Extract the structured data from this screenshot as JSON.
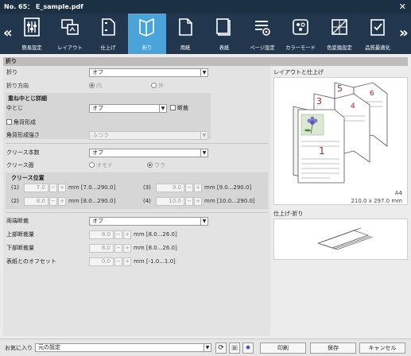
{
  "window": {
    "title": "No. 65： E_sample.pdf",
    "close": "✕"
  },
  "toolbar": {
    "prev": "«",
    "next": "»",
    "items": [
      {
        "label": "簡易設定",
        "icon": "simple-settings-icon"
      },
      {
        "label": "レイアウト",
        "icon": "layout-icon"
      },
      {
        "label": "仕上げ",
        "icon": "finishing-icon"
      },
      {
        "label": "折り",
        "icon": "fold-icon",
        "active": true
      },
      {
        "label": "用紙",
        "icon": "paper-icon"
      },
      {
        "label": "表紙",
        "icon": "cover-icon"
      },
      {
        "label": "ページ設定",
        "icon": "page-settings-icon"
      },
      {
        "label": "カラーモード",
        "icon": "color-mode-icon"
      },
      {
        "label": "色変換設定",
        "icon": "color-conversion-icon"
      },
      {
        "label": "品質最適化",
        "icon": "quality-icon"
      }
    ]
  },
  "section_title": "折り",
  "fold": {
    "label": "折り",
    "value": "オフ",
    "direction_label": "折り方向",
    "direction_in": "内",
    "direction_out": "外"
  },
  "saddle": {
    "title": "重ね中とじ詳細",
    "stitch_label": "中とじ",
    "stitch_value": "オフ",
    "trim_label": "断裁",
    "square_label": "角背形成",
    "strength_label": "角背形成強さ",
    "strength_value": "ふつう"
  },
  "crease": {
    "count_label": "クリース本数",
    "count_value": "オフ",
    "side_label": "クリース面",
    "side_front": "オモテ",
    "side_back": "ウラ",
    "pos_title": "クリース位置",
    "positions": [
      {
        "label": "(1)",
        "value": "7.0",
        "range": "mm [7.0...290.0]"
      },
      {
        "label": "(2)",
        "value": "8.0",
        "range": "mm [8.0...290.0]"
      },
      {
        "label": "(3)",
        "value": "9.0",
        "range": "mm [9.0...290.0]"
      },
      {
        "label": "(4)",
        "value": "10.0",
        "range": "mm [10.0...290.0]"
      }
    ]
  },
  "trim": {
    "label": "両端断裁",
    "value": "オフ",
    "top_label": "上部断裁量",
    "top_value": "8.0",
    "top_range": "mm [8.0...26.0]",
    "bottom_label": "下部断裁量",
    "bottom_value": "8.0",
    "bottom_range": "mm [8.0...26.0]",
    "offset_label": "表紙とのオフセット",
    "offset_value": "0.0",
    "offset_range": "mm [-1.0...1.0]"
  },
  "spin": {
    "minus": "−",
    "plus": "+"
  },
  "preview": {
    "layout_title": "レイアウトと仕上げ",
    "pages": [
      "5",
      "6",
      "3",
      "4",
      "1"
    ],
    "paper_size": "A4",
    "paper_dims": "210.0 x 297.0 mm",
    "fold_title": "仕上げ-折り"
  },
  "footer": {
    "favorites_label": "お気に入り",
    "favorites_value": "元の設定",
    "print": "印刷",
    "save": "保存",
    "cancel": "キャンセル"
  },
  "colors": {
    "header": "#1c3044",
    "toolbar": "#22374d",
    "active_tab": "#4aa3d9",
    "page_number": "#b0202a"
  }
}
